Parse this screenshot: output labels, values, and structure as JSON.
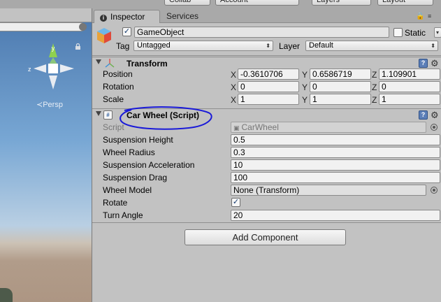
{
  "toolbar": {
    "collab_label": "Collab",
    "account_label": "Account",
    "layers_label": "Layers",
    "layout_label": "Layout"
  },
  "scene": {
    "gizmo_axes": [
      "y",
      "z"
    ],
    "persp_label": "Persp",
    "icons": [
      "lock-icon",
      "search-clear-icon"
    ]
  },
  "tabs": [
    {
      "label": "Inspector",
      "active": true
    },
    {
      "label": "Services",
      "active": false
    }
  ],
  "gameobject": {
    "active": true,
    "name": "GameObject",
    "static_label": "Static",
    "static": false,
    "tag_label": "Tag",
    "tag_value": "Untagged",
    "layer_label": "Layer",
    "layer_value": "Default"
  },
  "transform": {
    "title": "Transform",
    "rows": [
      {
        "label": "Position",
        "x": "-0.3610706",
        "y": "0.6586719",
        "z": "1.109901"
      },
      {
        "label": "Rotation",
        "x": "0",
        "y": "0",
        "z": "0"
      },
      {
        "label": "Scale",
        "x": "1",
        "y": "1",
        "z": "1"
      }
    ],
    "axis_labels": [
      "X",
      "Y",
      "Z"
    ]
  },
  "car_wheel": {
    "title": "Car Wheel (Script)",
    "script_label": "Script",
    "script_value": "CarWheel",
    "fields": [
      {
        "label": "Suspension Height",
        "value": "0.5"
      },
      {
        "label": "Wheel Radius",
        "value": "0.3"
      },
      {
        "label": "Suspension Acceleration",
        "value": "10"
      },
      {
        "label": "Suspension Drag",
        "value": "100"
      }
    ],
    "wheel_model_label": "Wheel Model",
    "wheel_model_value": "None (Transform)",
    "rotate_label": "Rotate",
    "rotate_checked": true,
    "turn_angle_label": "Turn Angle",
    "turn_angle_value": "20"
  },
  "add_component_label": "Add Component",
  "colors": {
    "panel_bg": "#c2c2c2",
    "annotation": "#1a1ad8",
    "help_icon": "#5c7fb8"
  }
}
